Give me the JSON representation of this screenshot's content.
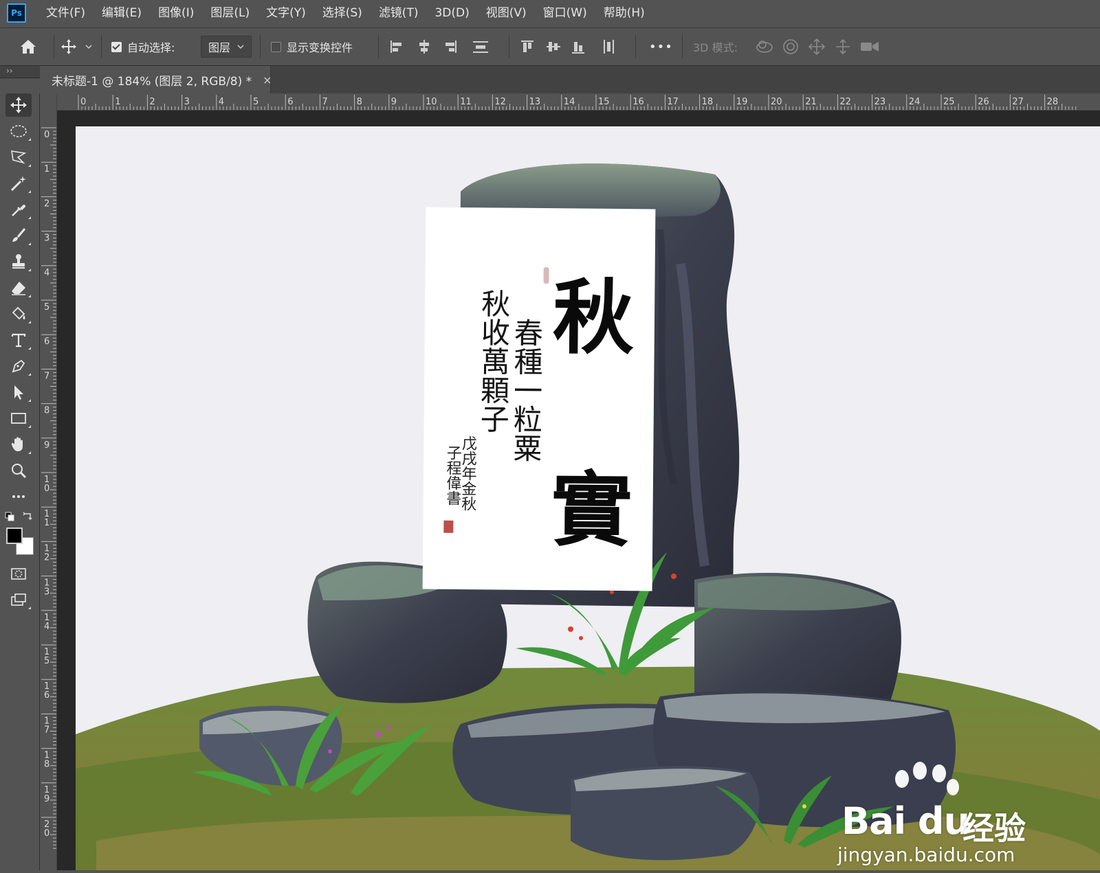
{
  "app": {
    "logo_text": "Ps"
  },
  "menu": [
    "文件(F)",
    "编辑(E)",
    "图像(I)",
    "图层(L)",
    "文字(Y)",
    "选择(S)",
    "滤镜(T)",
    "3D(D)",
    "视图(V)",
    "窗口(W)",
    "帮助(H)"
  ],
  "options": {
    "auto_select_label": "自动选择:",
    "auto_select_checked": true,
    "auto_select_target": "图层",
    "transform_controls_label": "显示变换控件",
    "transform_controls_checked": false,
    "more_label": "•••",
    "mode_3d_label": "3D 模式:"
  },
  "document_tab": {
    "title": "未标题-1 @ 184% (图层 2, RGB/8) *",
    "close": "×"
  },
  "panel_collapse": "››",
  "tools": [
    "move-tool",
    "elliptical-marquee-tool",
    "polygonal-lasso-tool",
    "magic-wand-tool",
    "eyedropper-tool",
    "brush-tool",
    "clone-stamp-tool",
    "eraser-tool",
    "paint-bucket-tool",
    "type-tool",
    "pen-tool",
    "path-selection-tool",
    "rectangle-tool",
    "hand-tool",
    "zoom-tool",
    "edit-toolbar"
  ],
  "colors": {
    "foreground": "#000000",
    "background": "#ffffff",
    "ps_blue": "#31a8ff"
  },
  "ruler_h": [
    "0",
    "1",
    "2",
    "3",
    "4",
    "5",
    "6",
    "7",
    "8",
    "9",
    "10",
    "11",
    "12",
    "13",
    "14",
    "15",
    "16",
    "17",
    "18",
    "19",
    "20",
    "21",
    "22",
    "23",
    "24",
    "25",
    "26",
    "27",
    "28"
  ],
  "ruler_v": [
    "0",
    "1",
    "2",
    "3",
    "4",
    "5",
    "6",
    "7",
    "8",
    "9",
    "1 0",
    "1 1",
    "1 2",
    "1 3",
    "1 4",
    "1 5",
    "1 6",
    "1 7",
    "1 8",
    "1 9",
    "2 0"
  ],
  "calligraphy": {
    "title_chars": [
      "秋",
      "實"
    ],
    "lines": [
      "春種一粒粟",
      "秋收萬顆子"
    ],
    "inscription": [
      "戊戌年金秋",
      "子程偉書"
    ]
  },
  "watermark": {
    "logo": "Bai du",
    "cn": "经验",
    "url": "jingyan.baidu.com"
  }
}
